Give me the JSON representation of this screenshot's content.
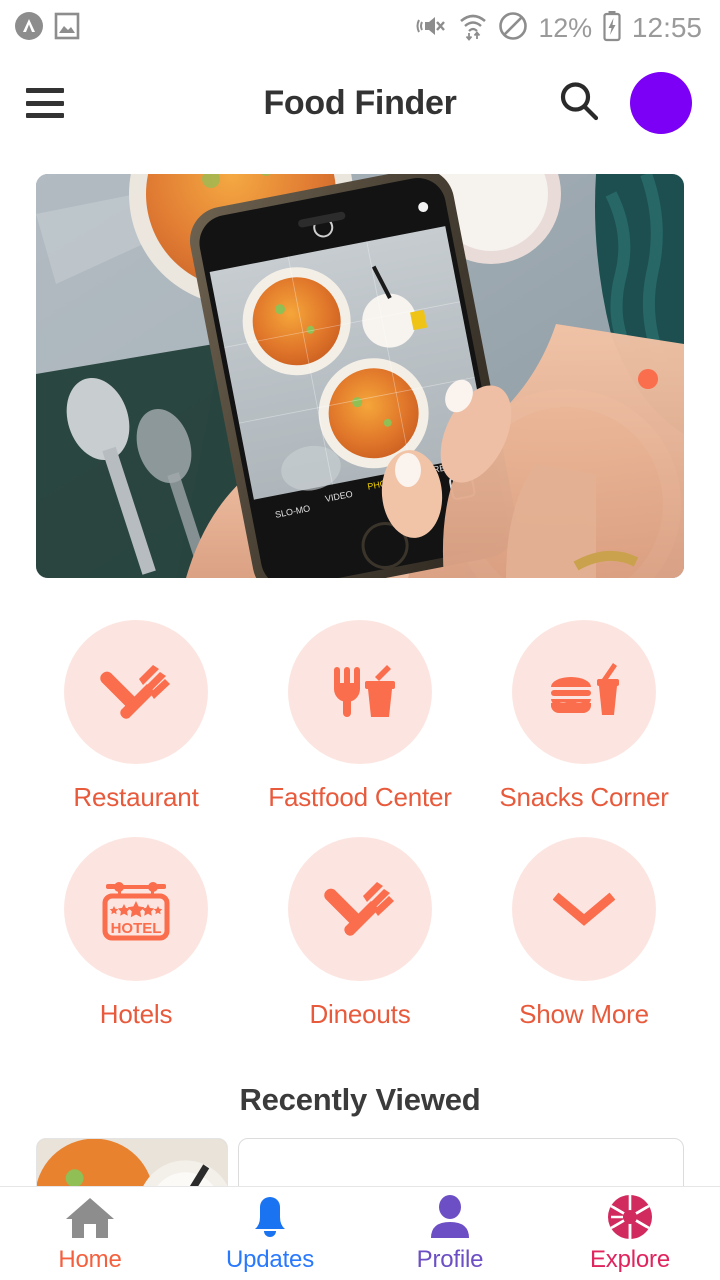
{
  "status_bar": {
    "left_icons": [
      "app-circle-chevron-icon",
      "screenshot-image-icon"
    ],
    "right_icons": [
      "vibrate-mute-icon",
      "wifi-data-icon",
      "do-not-disturb-icon",
      "battery-charging-icon"
    ],
    "battery_percent": "12%",
    "time": "12:55",
    "text_color": "#9a9a9a"
  },
  "app_bar": {
    "menu_icon": "hamburger-menu-icon",
    "title": "Food Finder",
    "search_icon": "search-icon",
    "avatar_icon": "avatar-circle",
    "avatar_color": "#7B00F5",
    "title_color": "#333333"
  },
  "hero": {
    "alt": "hands holding smartphone photographing bowls of soup",
    "indicator_icon": "carousel-dot-indicator",
    "indicator_color": "#FA6D4D"
  },
  "categories": {
    "accent_color": "#E85A3C",
    "icon_color": "#FA6D4D",
    "circle_color": "#FCE5E0",
    "items": [
      {
        "label": "Restaurant",
        "icon": "fork-knife-crossed-icon"
      },
      {
        "label": "Fastfood Center",
        "icon": "fork-drink-cup-icon"
      },
      {
        "label": "Snacks Corner",
        "icon": "burger-drink-cup-icon"
      },
      {
        "label": "Hotels",
        "icon": "hotel-sign-icon"
      },
      {
        "label": "Dineouts",
        "icon": "fork-knife-crossed-icon"
      },
      {
        "label": "Show More",
        "icon": "chevron-down-icon"
      }
    ]
  },
  "recently_viewed": {
    "title": "Recently Viewed",
    "cards": [
      {
        "name": "recent-card-thumbnail"
      },
      {
        "name": "recent-card-placeholder"
      }
    ]
  },
  "bottom_nav": {
    "items": [
      {
        "label": "Home",
        "icon": "home-icon",
        "icon_color": "#8d8d8d",
        "label_color": "#F4603E"
      },
      {
        "label": "Updates",
        "icon": "bell-icon",
        "icon_color": "#1A73F0",
        "label_color": "#2979FF"
      },
      {
        "label": "Profile",
        "icon": "person-icon",
        "icon_color": "#6C4FC4",
        "label_color": "#6C4FC4"
      },
      {
        "label": "Explore",
        "icon": "aperture-icon",
        "icon_color": "#D12A5E",
        "label_color": "#E0245E"
      }
    ]
  }
}
